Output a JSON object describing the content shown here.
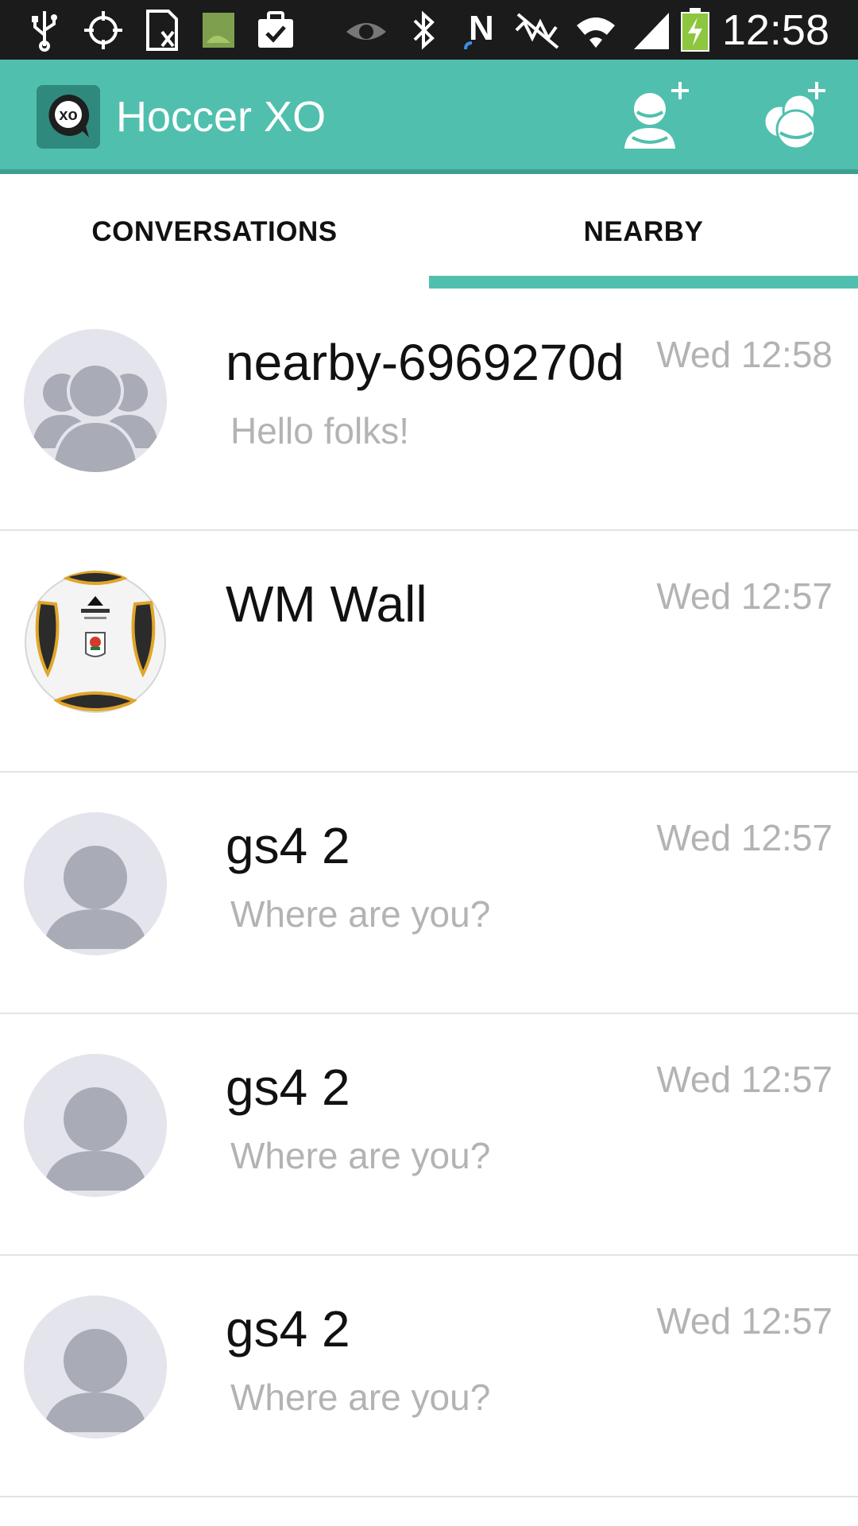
{
  "status_bar": {
    "time": "12:58",
    "icons": [
      "usb-icon",
      "gps-icon",
      "sim-icon",
      "android-icon",
      "task-icon",
      "eye-icon",
      "bluetooth-icon",
      "nfc-icon",
      "muted-icon",
      "wifi-icon",
      "signal-icon",
      "battery-charging-icon"
    ]
  },
  "app_bar": {
    "title": "Hoccer XO",
    "logo_text": "xo",
    "actions": [
      "add-contact-icon",
      "add-group-icon"
    ]
  },
  "tabs": [
    {
      "label": "CONVERSATIONS",
      "selected": false
    },
    {
      "label": "NEARBY",
      "selected": true
    }
  ],
  "accent_color": "#50bfae",
  "conversations": [
    {
      "name": "nearby-6969270d",
      "time": "Wed 12:58",
      "message": "Hello folks!",
      "avatar": "group-avatar-icon"
    },
    {
      "name": "WM Wall",
      "time": "Wed 12:57",
      "message": "",
      "avatar": "soccer-ball-avatar"
    },
    {
      "name": "gs4 2",
      "time": "Wed 12:57",
      "message": "Where are you?",
      "avatar": "person-avatar-icon"
    },
    {
      "name": "gs4 2",
      "time": "Wed 12:57",
      "message": "Where are you?",
      "avatar": "person-avatar-icon"
    },
    {
      "name": "gs4 2",
      "time": "Wed 12:57",
      "message": "Where are you?",
      "avatar": "person-avatar-icon"
    }
  ]
}
